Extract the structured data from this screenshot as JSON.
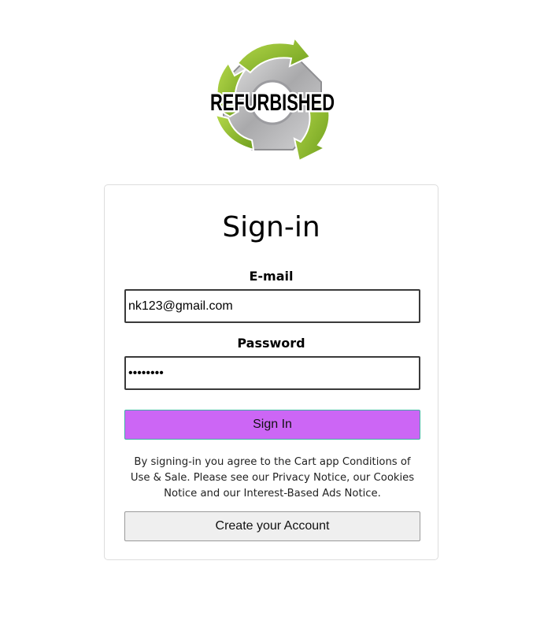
{
  "logo": {
    "text": "REFURBISHED",
    "icon": "recycle-gear-logo",
    "colors": {
      "arrow_green": "#8cc63f",
      "gear_gray": "#b8b8b8",
      "text": "#000000"
    }
  },
  "signin_form": {
    "title": "Sign-in",
    "email_label": "E-mail",
    "email_value": "nk123@gmail.com",
    "password_label": "Password",
    "password_value": "••••••••",
    "submit_label": "Sign In",
    "notice_text": "By signing-in you agree to the Cart app Conditions of Use & Sale. Please see our Privacy Notice, our Cookies Notice and our Interest-Based Ads Notice.",
    "create_account_label": "Create your Account"
  },
  "colors": {
    "submit_button_bg": "#cc66f5",
    "submit_button_border": "#3fb0a3",
    "create_button_bg": "#efefef",
    "card_border": "#dddddd"
  }
}
